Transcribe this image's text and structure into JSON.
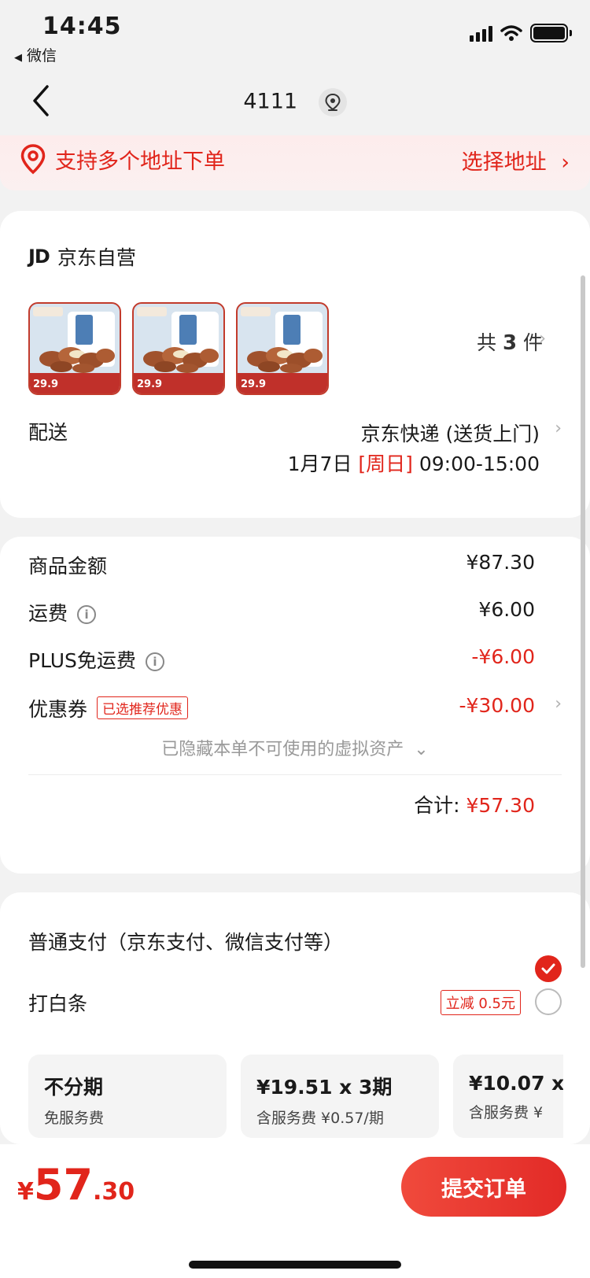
{
  "status": {
    "time": "14:45",
    "back_app": "微信"
  },
  "nav": {
    "title": "4111"
  },
  "address_banner": {
    "text": "支持多个地址下单",
    "action": "选择地址"
  },
  "shop": {
    "logo": "JD",
    "name": "京东自营"
  },
  "products": {
    "thumb_price": "29.9",
    "count_prefix": "共",
    "count": "3",
    "count_suffix": "件"
  },
  "delivery": {
    "label": "配送",
    "method": "京东快递 (送货上门)",
    "date": "1月7日",
    "weekday": "[周日]",
    "time_range": "09:00-15:00"
  },
  "summary": {
    "goods_label": "商品金额",
    "goods_value": "¥87.30",
    "freight_label": "运费",
    "freight_value": "¥6.00",
    "plus_label": "PLUS免运费",
    "plus_value": "-¥6.00",
    "coupon_label": "优惠券",
    "coupon_badge": "已选推荐优惠",
    "coupon_value": "-¥30.00",
    "hidden_note": "已隐藏本单不可使用的虚拟资产",
    "total_label": "合计:",
    "total_value": "¥57.30"
  },
  "payment": {
    "normal_label": "普通支付（京东支付、微信支付等）",
    "baitiao_label": "打白条",
    "baitiao_discount": "立减 0.5元",
    "plans": [
      {
        "title": "不分期",
        "sub": "免服务费"
      },
      {
        "title": "¥19.51 x 3期",
        "sub": "含服务费 ¥0.57/期"
      },
      {
        "title": "¥10.07 x",
        "sub": "含服务费 ¥"
      }
    ]
  },
  "bottom": {
    "price_symbol": "¥",
    "price_int": "57",
    "price_dec": ".30",
    "submit_label": "提交订单"
  },
  "colors": {
    "accent": "#e1251b",
    "banner_bg": "#fdecec"
  }
}
